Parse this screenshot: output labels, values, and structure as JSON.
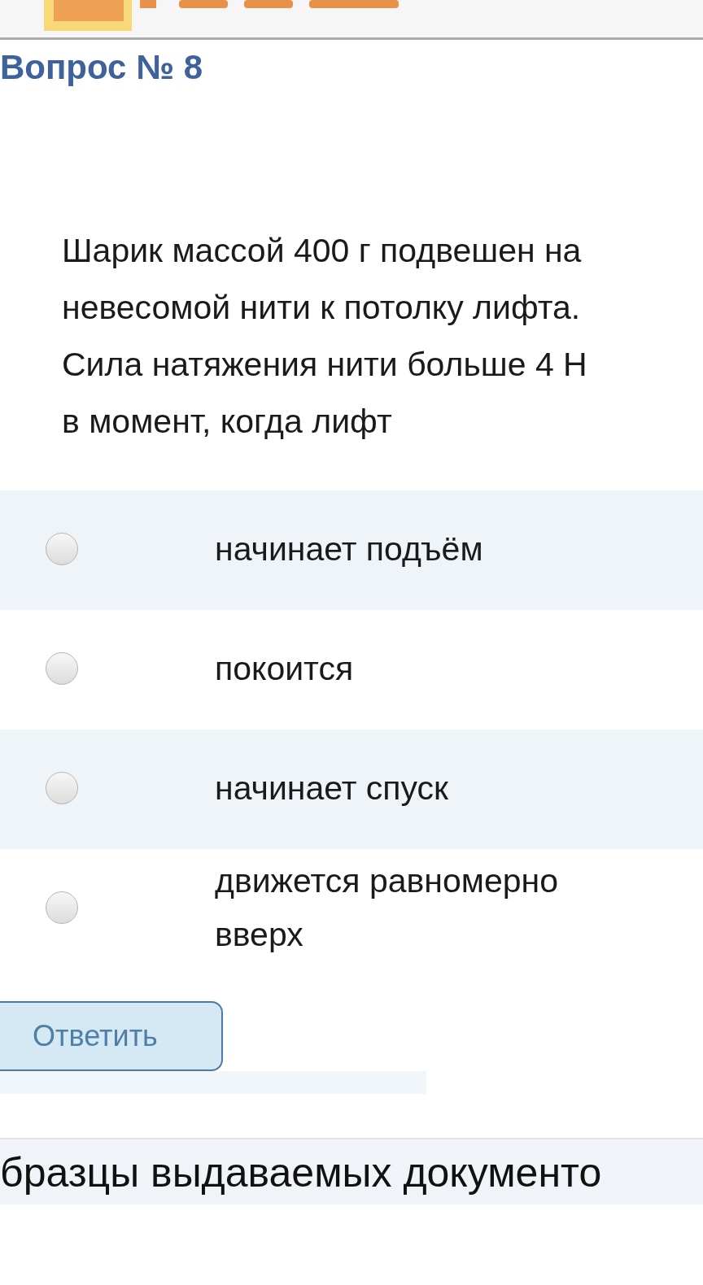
{
  "question": {
    "title": "Вопрос № 8",
    "text": "Шарик массой 400 г подвешен на невесомой нити к потолку лифта. Сила натяжения нити больше 4 Н в момент, когда лифт"
  },
  "options": [
    {
      "label": "начинает подъём",
      "selected": false
    },
    {
      "label": "покоится",
      "selected": false
    },
    {
      "label": "начинает спуск",
      "selected": false
    },
    {
      "label": "движется равномерно вверх",
      "selected": false
    }
  ],
  "submit_button": "Ответить",
  "section_heading": "бразцы выдаваемых документо"
}
